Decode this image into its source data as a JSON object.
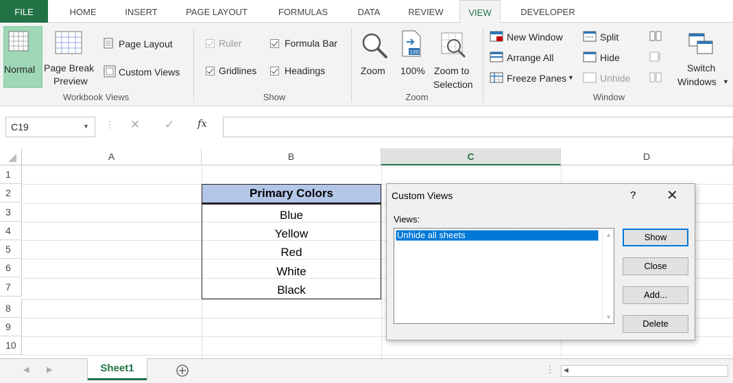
{
  "ribbon_tabs": [
    "FILE",
    "HOME",
    "INSERT",
    "PAGE LAYOUT",
    "FORMULAS",
    "DATA",
    "REVIEW",
    "VIEW",
    "DEVELOPER"
  ],
  "workbook_views": {
    "normal": "Normal",
    "page_break_line1": "Page Break",
    "page_break_line2": "Preview",
    "page_layout": "Page Layout",
    "custom_views": "Custom Views",
    "group_label": "Workbook Views"
  },
  "show": {
    "ruler": "Ruler",
    "formula_bar": "Formula Bar",
    "gridlines": "Gridlines",
    "headings": "Headings",
    "group_label": "Show"
  },
  "zoom": {
    "zoom": "Zoom",
    "hundred": "100%",
    "hundred_icon_text": "100",
    "to_selection_line1": "Zoom to",
    "to_selection_line2": "Selection",
    "group_label": "Zoom"
  },
  "window": {
    "new_window": "New Window",
    "arrange_all": "Arrange All",
    "freeze_panes": "Freeze Panes",
    "split": "Split",
    "hide": "Hide",
    "unhide": "Unhide",
    "switch_line1": "Switch",
    "switch_line2": "Windows",
    "group_label": "Window"
  },
  "formula_bar": {
    "name_box": "C19",
    "fx": "fx",
    "value": ""
  },
  "columns": [
    "A",
    "B",
    "C",
    "D"
  ],
  "rows": [
    "1",
    "2",
    "3",
    "4",
    "5",
    "6",
    "7",
    "8",
    "9",
    "10"
  ],
  "table": {
    "header": "Primary Colors",
    "values": [
      "Blue",
      "Yellow",
      "Red",
      "White",
      "Black"
    ]
  },
  "sheets": [
    "Sheet1"
  ],
  "dialog": {
    "title": "Custom Views",
    "help": "?",
    "close": "✕",
    "views_label": "Views:",
    "items": [
      "Unhide all sheets"
    ],
    "show_btn": "Show",
    "close_btn": "Close",
    "add_btn": "Add...",
    "delete_btn": "Delete"
  },
  "colors": {
    "excel_green": "#217346",
    "header_fill": "#b4c6e7",
    "selection_blue": "#0078d7"
  }
}
